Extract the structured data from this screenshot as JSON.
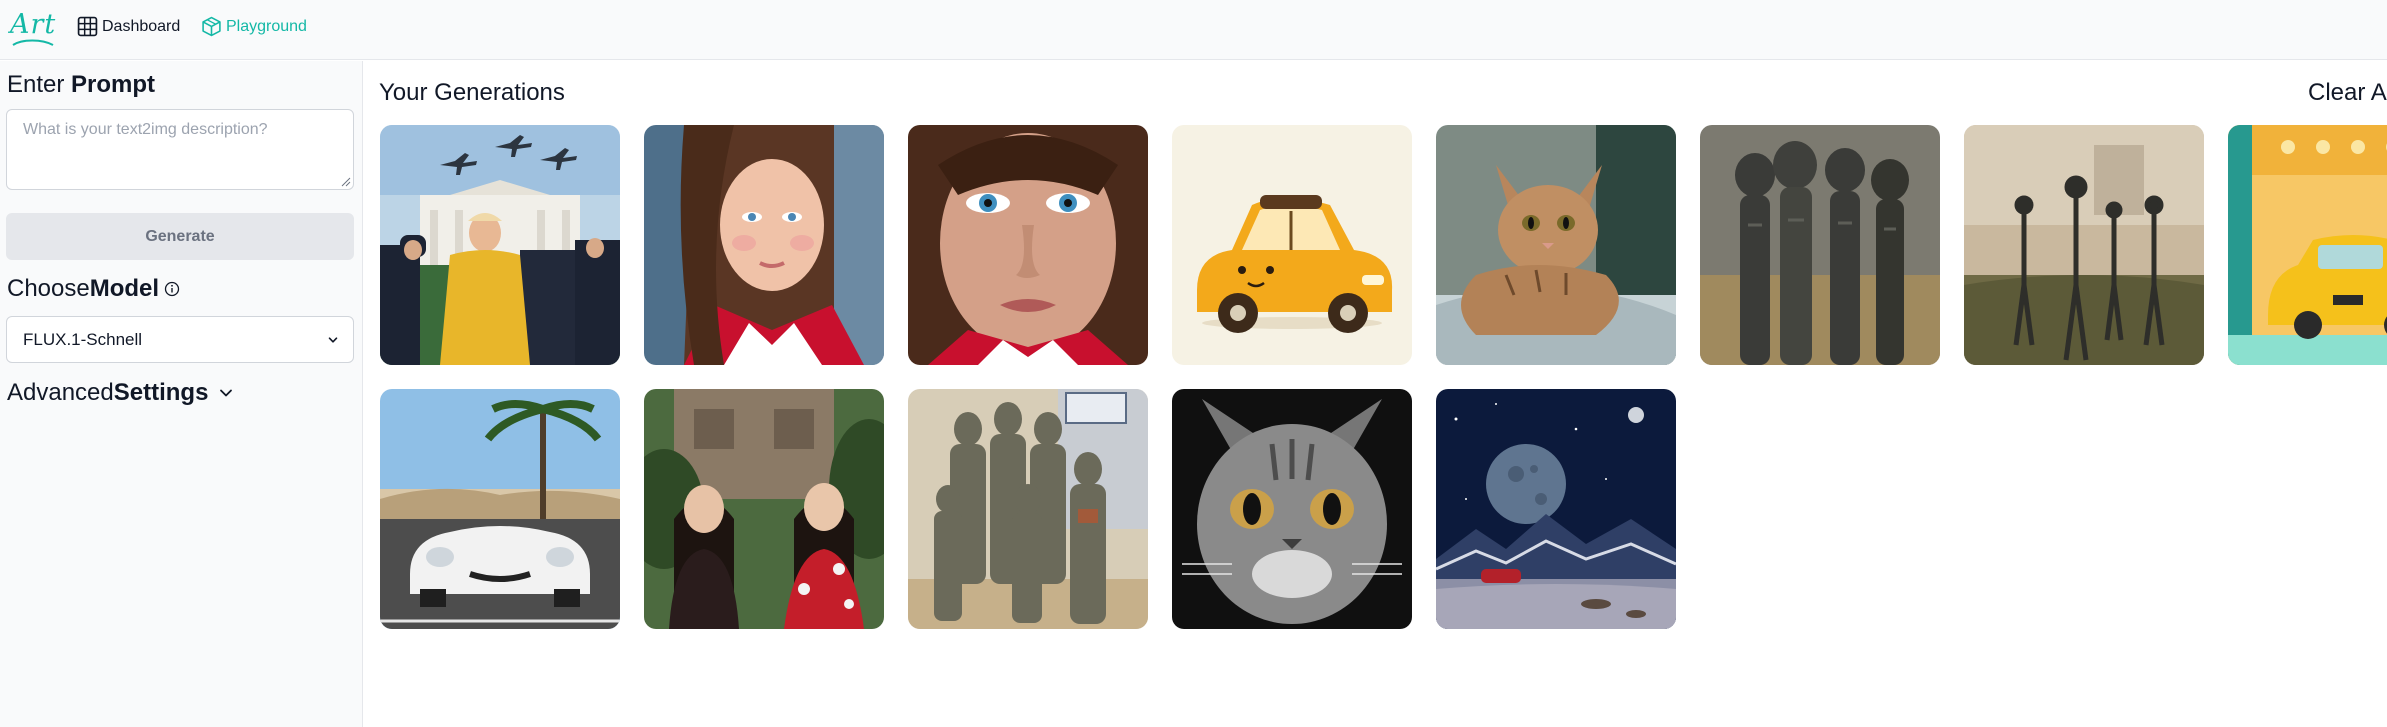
{
  "nav": {
    "logo_text": "Art",
    "dashboard_label": "Dashboard",
    "playground_label": "Playground",
    "accent_color": "#14b8a6"
  },
  "sidebar": {
    "prompt_heading_plain": "Enter ",
    "prompt_heading_bold": "Prompt",
    "prompt_placeholder": "What is your text2img description?",
    "prompt_value": "",
    "generate_label": "Generate",
    "model_heading_plain": "Choose",
    "model_heading_bold": "Model",
    "model_selected": "FLUX.1-Schnell",
    "advanced_plain": "Advanced ",
    "advanced_bold": "Settings"
  },
  "main": {
    "title": "Your Generations",
    "clear_label": "Clear A"
  },
  "icons": [
    "grid-icon",
    "cube-icon",
    "info-icon",
    "chevron-down-icon"
  ]
}
